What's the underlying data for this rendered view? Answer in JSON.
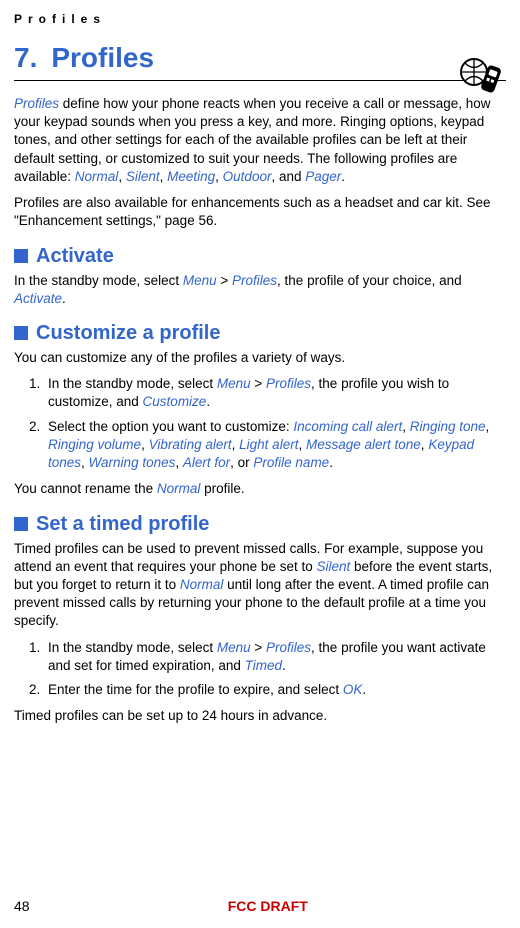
{
  "header": {
    "running_label": "Profiles"
  },
  "chapter": {
    "number": "7.",
    "title": "Profiles"
  },
  "intro1_parts": [
    {
      "t": "key",
      "v": "Profiles"
    },
    {
      "t": "txt",
      "v": " define how your phone reacts when you receive a call or message, how your keypad sounds when you press a key, and more. Ringing options, keypad tones, and other settings for each of the available profiles can be left at their default setting, or customized to suit your needs. The following profiles are available: "
    },
    {
      "t": "key",
      "v": "Normal"
    },
    {
      "t": "txt",
      "v": ", "
    },
    {
      "t": "key",
      "v": "Silent"
    },
    {
      "t": "txt",
      "v": ", "
    },
    {
      "t": "key",
      "v": "Meeting"
    },
    {
      "t": "txt",
      "v": ", "
    },
    {
      "t": "key",
      "v": "Outdoor"
    },
    {
      "t": "txt",
      "v": ", and "
    },
    {
      "t": "key",
      "v": "Pager"
    },
    {
      "t": "txt",
      "v": "."
    }
  ],
  "intro2": "Profiles are also available for enhancements such as a headset and car kit.  See \"Enhancement settings,\" page 56.",
  "sections": {
    "activate": {
      "title": "Activate",
      "para_parts": [
        {
          "t": "txt",
          "v": "In the standby mode, select "
        },
        {
          "t": "key",
          "v": "Menu"
        },
        {
          "t": "txt",
          "v": " > "
        },
        {
          "t": "key",
          "v": "Profiles"
        },
        {
          "t": "txt",
          "v": ", the profile of your choice, and "
        },
        {
          "t": "key",
          "v": "Activate"
        },
        {
          "t": "txt",
          "v": "."
        }
      ]
    },
    "customize": {
      "title": "Customize a profile",
      "lead": "You can customize any of the profiles a variety of ways.",
      "steps": [
        [
          {
            "t": "txt",
            "v": "In the standby mode, select "
          },
          {
            "t": "key",
            "v": "Menu"
          },
          {
            "t": "txt",
            "v": " > "
          },
          {
            "t": "key",
            "v": "Profiles"
          },
          {
            "t": "txt",
            "v": ", the profile you wish to customize, and "
          },
          {
            "t": "key",
            "v": "Customize"
          },
          {
            "t": "txt",
            "v": "."
          }
        ],
        [
          {
            "t": "txt",
            "v": "Select the option you want to customize: "
          },
          {
            "t": "key",
            "v": "Incoming call alert"
          },
          {
            "t": "txt",
            "v": ", "
          },
          {
            "t": "key",
            "v": "Ringing tone"
          },
          {
            "t": "txt",
            "v": ", "
          },
          {
            "t": "key",
            "v": "Ringing volume"
          },
          {
            "t": "txt",
            "v": ", "
          },
          {
            "t": "key",
            "v": "Vibrating alert"
          },
          {
            "t": "txt",
            "v": ", "
          },
          {
            "t": "key",
            "v": "Light alert"
          },
          {
            "t": "txt",
            "v": ", "
          },
          {
            "t": "key",
            "v": "Message alert tone"
          },
          {
            "t": "txt",
            "v": ", "
          },
          {
            "t": "key",
            "v": "Keypad tones"
          },
          {
            "t": "txt",
            "v": ", "
          },
          {
            "t": "key",
            "v": "Warning tones"
          },
          {
            "t": "txt",
            "v": ", "
          },
          {
            "t": "key",
            "v": "Alert for"
          },
          {
            "t": "txt",
            "v": ", or "
          },
          {
            "t": "key",
            "v": "Profile name"
          },
          {
            "t": "txt",
            "v": "."
          }
        ]
      ],
      "note_parts": [
        {
          "t": "txt",
          "v": "You cannot rename the "
        },
        {
          "t": "key",
          "v": "Normal"
        },
        {
          "t": "txt",
          "v": " profile."
        }
      ]
    },
    "timed": {
      "title": "Set a timed profile",
      "lead_parts": [
        {
          "t": "txt",
          "v": "Timed profiles can be used to prevent missed calls. For example, suppose you attend an event that requires your phone be set to "
        },
        {
          "t": "key",
          "v": "Silent"
        },
        {
          "t": "txt",
          "v": " before the event starts, but you forget to return it to "
        },
        {
          "t": "key",
          "v": "Normal"
        },
        {
          "t": "txt",
          "v": " until long after the event. A timed profile can prevent missed calls by returning your phone to the default profile at a time you specify."
        }
      ],
      "steps": [
        [
          {
            "t": "txt",
            "v": "In the standby mode, select "
          },
          {
            "t": "key",
            "v": "Menu"
          },
          {
            "t": "txt",
            "v": " > "
          },
          {
            "t": "key",
            "v": "Profiles"
          },
          {
            "t": "txt",
            "v": ", the profile you want activate and set for timed expiration, and "
          },
          {
            "t": "key",
            "v": "Timed"
          },
          {
            "t": "txt",
            "v": "."
          }
        ],
        [
          {
            "t": "txt",
            "v": "Enter the time for the profile to expire, and select "
          },
          {
            "t": "key",
            "v": "OK"
          },
          {
            "t": "txt",
            "v": "."
          }
        ]
      ],
      "note": "Timed profiles can be set up to 24 hours in advance."
    }
  },
  "footer": {
    "page_number": "48",
    "stamp": "FCC DRAFT"
  }
}
